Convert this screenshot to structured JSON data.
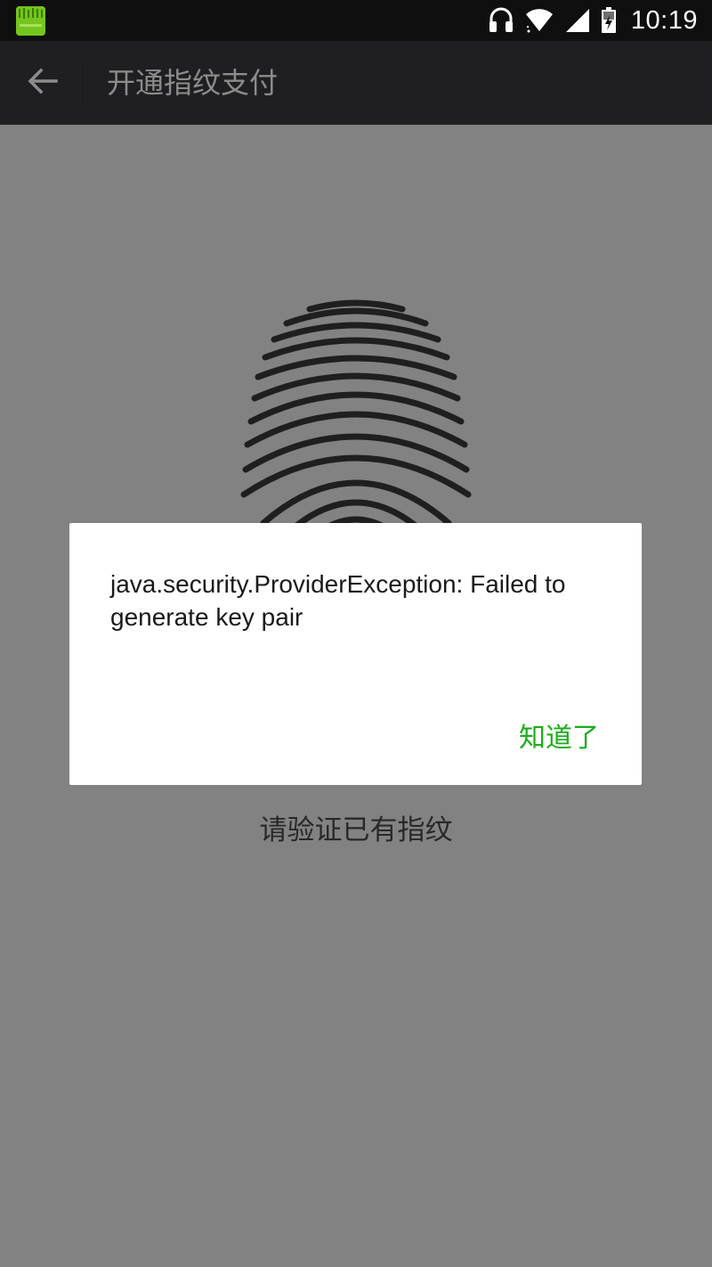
{
  "status_bar": {
    "time": "10:19",
    "app_icon": "app-notification-icon",
    "icons": [
      "headphones-icon",
      "wifi-icon",
      "cellular-signal-icon",
      "battery-icon"
    ]
  },
  "action_bar": {
    "back_icon": "back-arrow-icon",
    "title": "开通指纹支付"
  },
  "main": {
    "fingerprint_icon": "fingerprint-icon",
    "hint": "请验证已有指纹"
  },
  "dialog": {
    "message": "java.security.ProviderException: Failed to generate key pair",
    "confirm_label": "知道了"
  },
  "colors": {
    "accent": "#1aad19",
    "action_bar": "#393a3f",
    "status_bar": "#0f0f0f"
  }
}
